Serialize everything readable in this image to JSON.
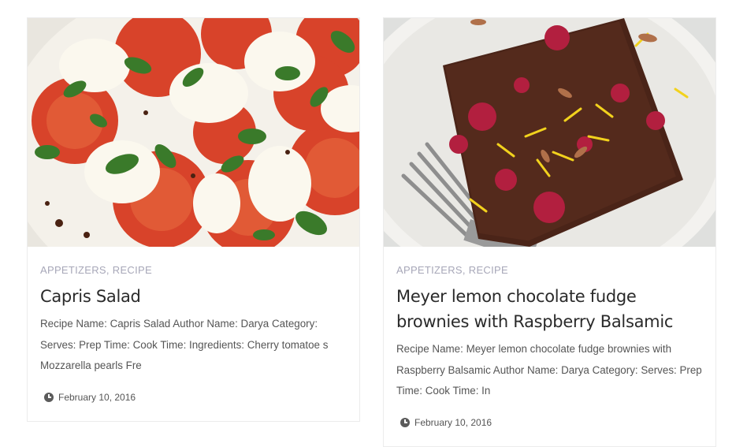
{
  "posts": [
    {
      "categories": [
        "APPETIZERS",
        "RECIPE"
      ],
      "category_sep": ", ",
      "title": "Capris Salad",
      "excerpt": "Recipe Name: Capris Salad Author Name: Darya Category: Serves: Prep Time: Cook Time: Ingredients: Cherry tomatoe s Mozzarella pearls Fre",
      "date": "February 10, 2016",
      "image": "caprese-salad-photo"
    },
    {
      "categories": [
        "APPETIZERS",
        "RECIPE"
      ],
      "category_sep": ", ",
      "title": "Meyer lemon chocolate fudge brownies with Raspberry Balsamic",
      "excerpt": "Recipe Name: Meyer lemon chocolate fudge brownies with Raspberry Balsamic Author Name: Darya Category: Serves: Prep Time: Cook Time: In",
      "date": "February 10, 2016",
      "image": "brownie-photo"
    }
  ],
  "colors": {
    "category": "#a7a7b8",
    "title": "#2a2a2a",
    "excerpt": "#555555",
    "border": "#ececec"
  }
}
